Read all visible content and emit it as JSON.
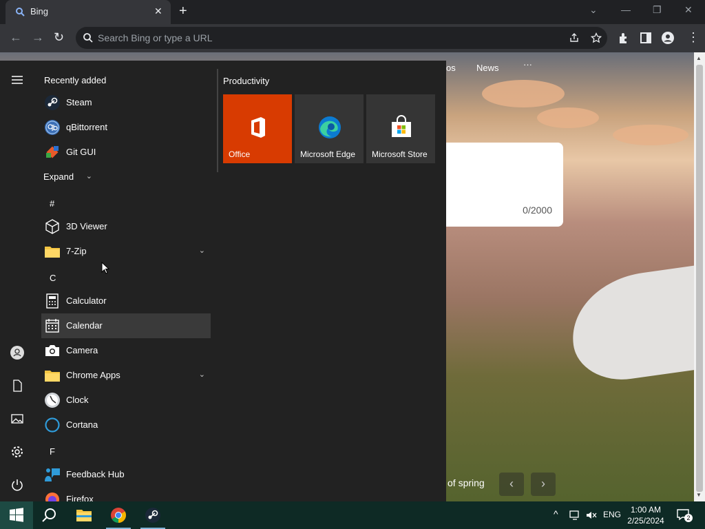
{
  "browser": {
    "tab_title": "Bing",
    "address_placeholder": "Search Bing or type a URL"
  },
  "page": {
    "nav_partial": "os",
    "nav_news": "News",
    "nav_more": "···",
    "search_counter": "0/2000",
    "caption": "of spring"
  },
  "start_menu": {
    "recently_added_title": "Recently added",
    "recent_apps": [
      {
        "label": "Steam",
        "icon": "steam-icon"
      },
      {
        "label": "qBittorrent",
        "icon": "qbittorrent-icon"
      },
      {
        "label": "Git GUI",
        "icon": "git-gui-icon"
      }
    ],
    "expand_label": "Expand",
    "groups": [
      {
        "letter": "#",
        "apps": [
          {
            "label": "3D Viewer",
            "icon": "cube-icon"
          },
          {
            "label": "7-Zip",
            "icon": "folder-icon"
          }
        ]
      },
      {
        "letter": "C",
        "apps": [
          {
            "label": "Calculator",
            "icon": "calculator-icon"
          },
          {
            "label": "Calendar",
            "icon": "calendar-icon"
          },
          {
            "label": "Camera",
            "icon": "camera-icon"
          },
          {
            "label": "Chrome Apps",
            "icon": "folder-icon"
          },
          {
            "label": "Clock",
            "icon": "clock-icon"
          },
          {
            "label": "Cortana",
            "icon": "cortana-icon"
          }
        ]
      },
      {
        "letter": "F",
        "apps": [
          {
            "label": "Feedback Hub",
            "icon": "feedback-icon"
          },
          {
            "label": "Firefox",
            "icon": "firefox-icon"
          }
        ]
      }
    ],
    "productivity_title": "Productivity",
    "tiles": [
      {
        "label": "Office",
        "color": "#d83b01"
      },
      {
        "label": "Microsoft Edge",
        "color": "#353535"
      },
      {
        "label": "Microsoft Store",
        "color": "#353535"
      }
    ]
  },
  "taskbar": {
    "language": "ENG",
    "time": "1:00 AM",
    "date": "2/25/2024",
    "notification_count": "2"
  },
  "colors": {
    "office_orange": "#d83b01",
    "start_bg": "#222222",
    "taskbar_bg": "#0e2a25",
    "chrome_dark": "#202124"
  }
}
